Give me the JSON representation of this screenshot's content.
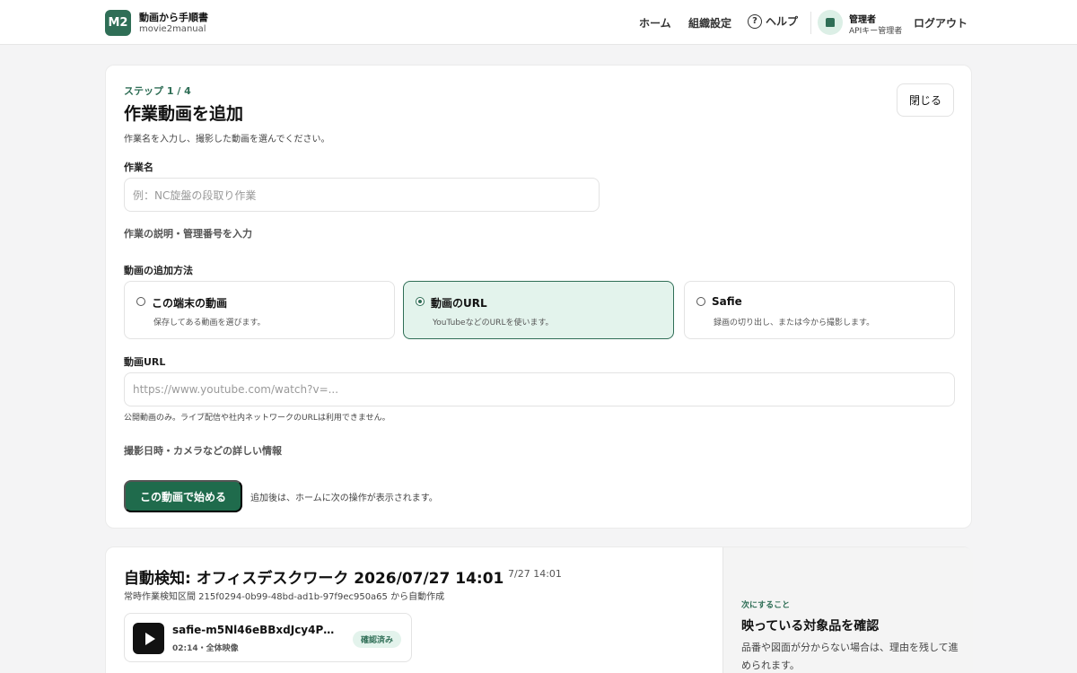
{
  "header": {
    "logo_badge": "M2",
    "app_title": "動画から手順書",
    "app_subtitle": "movie2manual",
    "nav": {
      "home": "ホーム",
      "org_settings": "組織設定",
      "help": "ヘルプ",
      "logout": "ログアウト"
    },
    "help_icon_glyph": "?",
    "user": {
      "name": "管理者",
      "role": "APIキー管理者"
    }
  },
  "add_video": {
    "step": "ステップ 1 / 4",
    "title": "作業動画を追加",
    "close_label": "閉じる",
    "intro": "作業名を入力し、撮影した動画を選んでください。",
    "task_name_label": "作業名",
    "task_name_placeholder": "例：NC旋盤の段取り作業",
    "task_name_value": "",
    "description_toggle": "作業の説明・管理番号を入力",
    "method_label": "動画の追加方法",
    "methods": [
      {
        "title": "この端末の動画",
        "desc": "保存してある動画を選びます。",
        "selected": false
      },
      {
        "title": "動画のURL",
        "desc": "YouTubeなどのURLを使います。",
        "selected": true
      },
      {
        "title": "Safie",
        "desc": "録画の切り出し、または今から撮影します。",
        "selected": false
      }
    ],
    "url_label": "動画URL",
    "url_placeholder": "https://www.youtube.com/watch?v=...",
    "url_value": "",
    "url_hint": "公開動画のみ。ライブ配信や社内ネットワークのURLは利用できません。",
    "details_toggle": "撮影日時・カメラなどの詳しい情報",
    "start_label": "この動画で始める",
    "after_note": "追加後は、ホームに次の操作が表示されます。"
  },
  "auto_detect": {
    "title": "自動検知: オフィスデスクワーク 2026/07/27 14:01",
    "time": "7/27 14:01",
    "subtitle": "常時作業検知区間 215f0294-0b99-48bd-ad1b-97f9ec950a65 から自動作成",
    "video_name": "safie-m5Nl46eBBxdJcy4P…",
    "video_meta": "02:14・全体映像",
    "badge": "確認済み",
    "next_label": "次にすること",
    "next_title": "映っている対象品を確認",
    "next_desc": "品番や図面が分からない場合は、理由を残して進められます。"
  },
  "colors": {
    "brand": "#2f6e56",
    "primary_button": "#1f6b4c",
    "selected_bg": "#e3f3ec"
  }
}
